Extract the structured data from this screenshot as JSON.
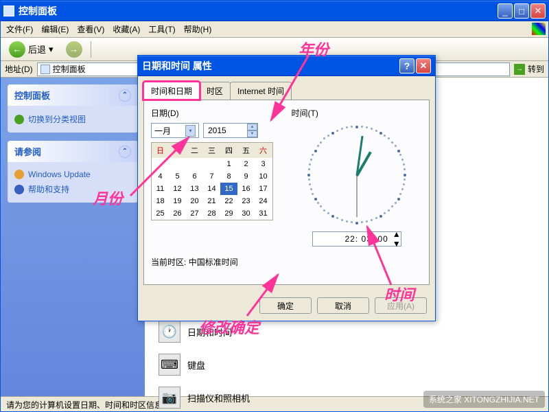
{
  "window": {
    "title": "控制面板",
    "min": "_",
    "max": "□",
    "close": "✕"
  },
  "menu": {
    "file": "文件(F)",
    "edit": "编辑(E)",
    "view": "查看(V)",
    "fav": "收藏(A)",
    "tools": "工具(T)",
    "help": "帮助(H)"
  },
  "toolbar": {
    "back": "后退",
    "back_arrow": "←",
    "fwd_arrow": "→",
    "drop": "▾"
  },
  "addressbar": {
    "label": "地址(D)",
    "value": "控制面板",
    "go": "转到",
    "go_icon": "→"
  },
  "sidebar": {
    "panel1_title": "控制面板",
    "panel1_link": "切换到分类视图",
    "panel2_title": "请参阅",
    "panel2_links": [
      "Windows Update",
      "帮助和支持"
    ]
  },
  "content": {
    "item_datetime": "日期和时间",
    "item_keyboard": "键盘",
    "item_scanner": "扫描仪和照相机"
  },
  "dialog": {
    "title": "日期和时间 属性",
    "help": "?",
    "close": "✕",
    "tabs": [
      "时间和日期",
      "时区",
      "Internet 时间"
    ],
    "date_label": "日期(D)",
    "time_label": "时间(T)",
    "month": "一月",
    "month_arrow": "▾",
    "year": "2015",
    "weekdays": [
      "日",
      "一",
      "二",
      "三",
      "四",
      "五",
      "六"
    ],
    "cal": [
      [
        "",
        "",
        "",
        "",
        "1",
        "2",
        "3"
      ],
      [
        "4",
        "5",
        "6",
        "7",
        "8",
        "9",
        "10"
      ],
      [
        "11",
        "12",
        "13",
        "14",
        "15",
        "16",
        "17"
      ],
      [
        "18",
        "19",
        "20",
        "21",
        "22",
        "23",
        "24"
      ],
      [
        "25",
        "26",
        "27",
        "28",
        "29",
        "30",
        "31"
      ]
    ],
    "selected_day": "15",
    "time_value": "22: 03: 00",
    "tz_label": "当前时区:",
    "tz_value": "中国标准时间",
    "ok": "确定",
    "cancel": "取消",
    "apply": "应用(A)"
  },
  "annotations": {
    "year": "年份",
    "month": "月份",
    "time": "时间",
    "confirm": "修改确定"
  },
  "status": "请为您的计算机设置日期、时间和时区信息",
  "watermark": "系统之家 XITONGZHIJIA.NET"
}
